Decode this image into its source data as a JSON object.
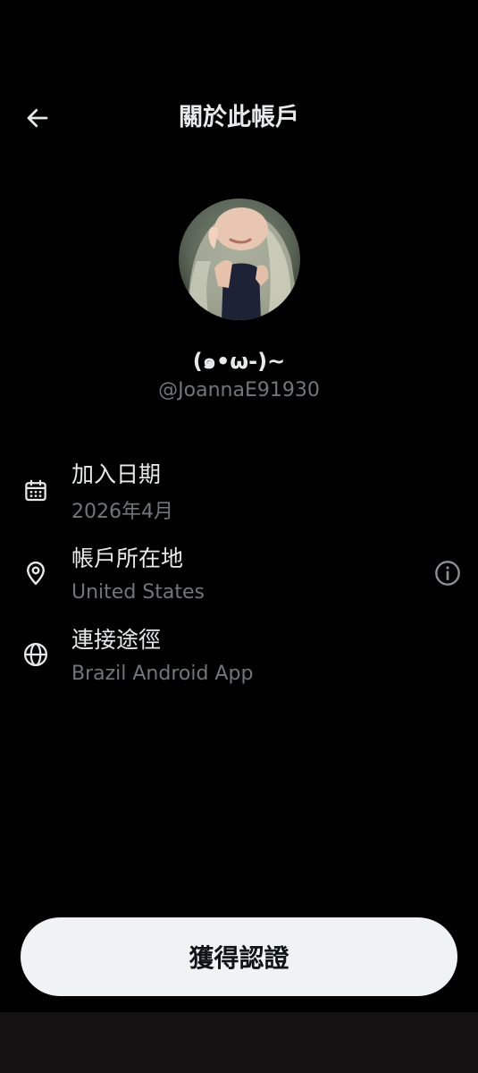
{
  "header": {
    "title": "關於此帳戶",
    "back_icon": "arrow-left-icon"
  },
  "profile": {
    "display_name": "(๑•ω-)~",
    "handle": "@JoannaE91930",
    "avatar_icon": "avatar-photo"
  },
  "info": [
    {
      "icon": "calendar-icon",
      "label": "加入日期",
      "value": "2026年4月"
    },
    {
      "icon": "location-pin-icon",
      "label": "帳戶所在地",
      "value": "United States"
    },
    {
      "icon": "globe-icon",
      "label": "連接途徑",
      "value": "Brazil Android App"
    }
  ],
  "info_button_icon": "info-circle-icon",
  "verify_button": {
    "label": "獲得認證"
  },
  "colors": {
    "background": "#000000",
    "primary_text": "#e7e9ea",
    "secondary_text": "#71767b",
    "button_bg": "#eff3f4",
    "button_text": "#0f1419"
  }
}
